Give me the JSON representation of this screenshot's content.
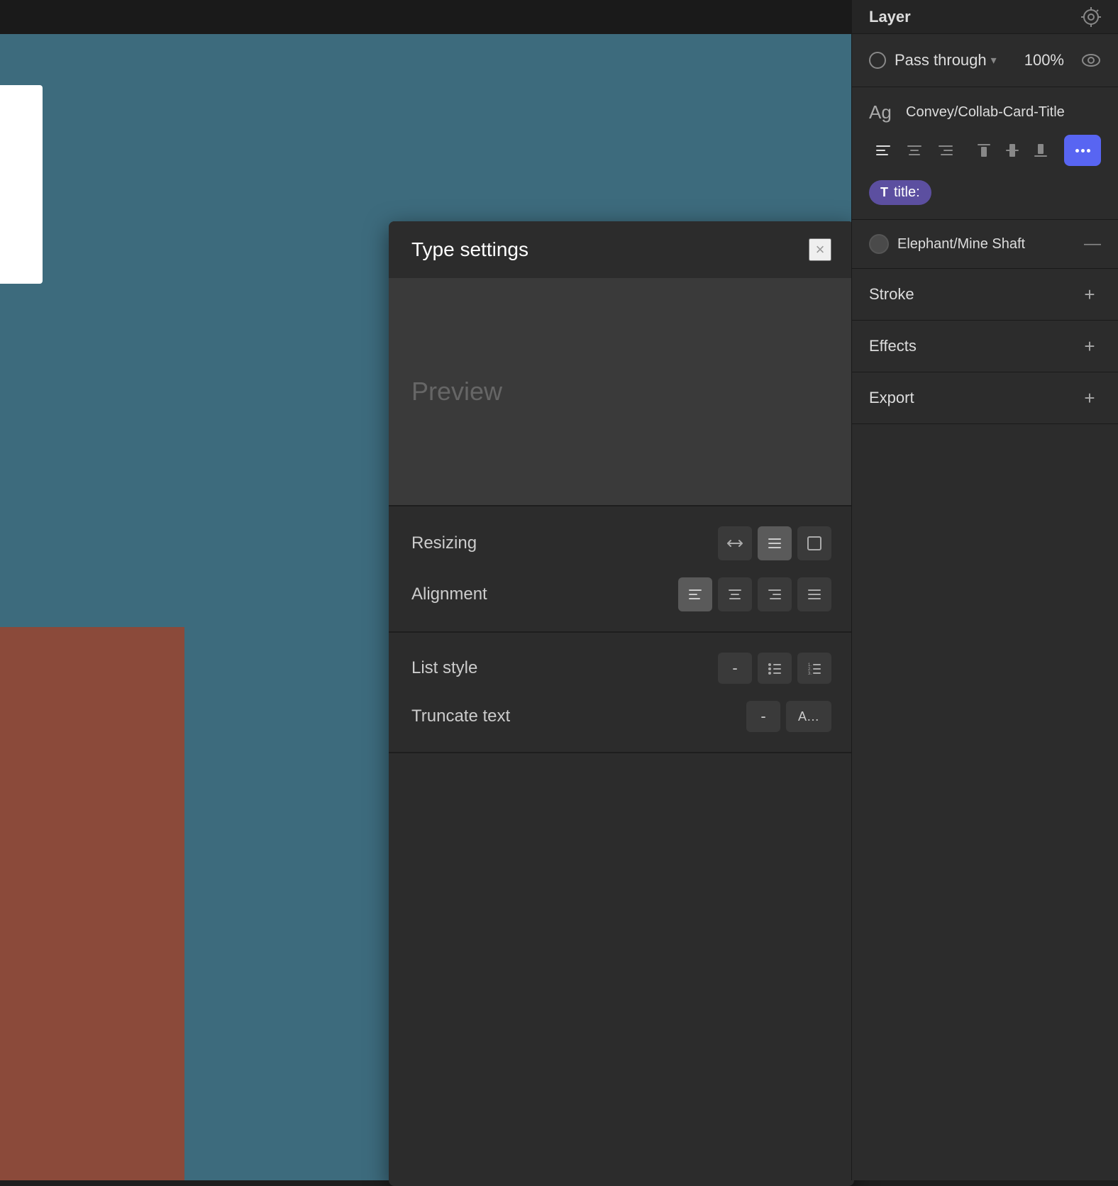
{
  "canvas": {
    "background_color": "#3d6b7d"
  },
  "type_settings_panel": {
    "title": "Type settings",
    "close_label": "×",
    "preview_text": "Preview",
    "resizing_label": "Resizing",
    "alignment_label": "Alignment",
    "list_style_label": "List style",
    "truncate_text_label": "Truncate text",
    "truncate_dash": "-",
    "truncate_ellipsis": "A…",
    "list_dash": "-"
  },
  "right_panel": {
    "header_title": "Layer",
    "blend_mode": "Pass through",
    "opacity": "100%",
    "text_style_name": "Convey/Collab-Card-Title",
    "ag_label": "Ag",
    "text_tag_label": "title:",
    "fill_name": "Elephant/Mine Shaft",
    "stroke_label": "Stroke",
    "effects_label": "Effects",
    "export_label": "Export"
  }
}
